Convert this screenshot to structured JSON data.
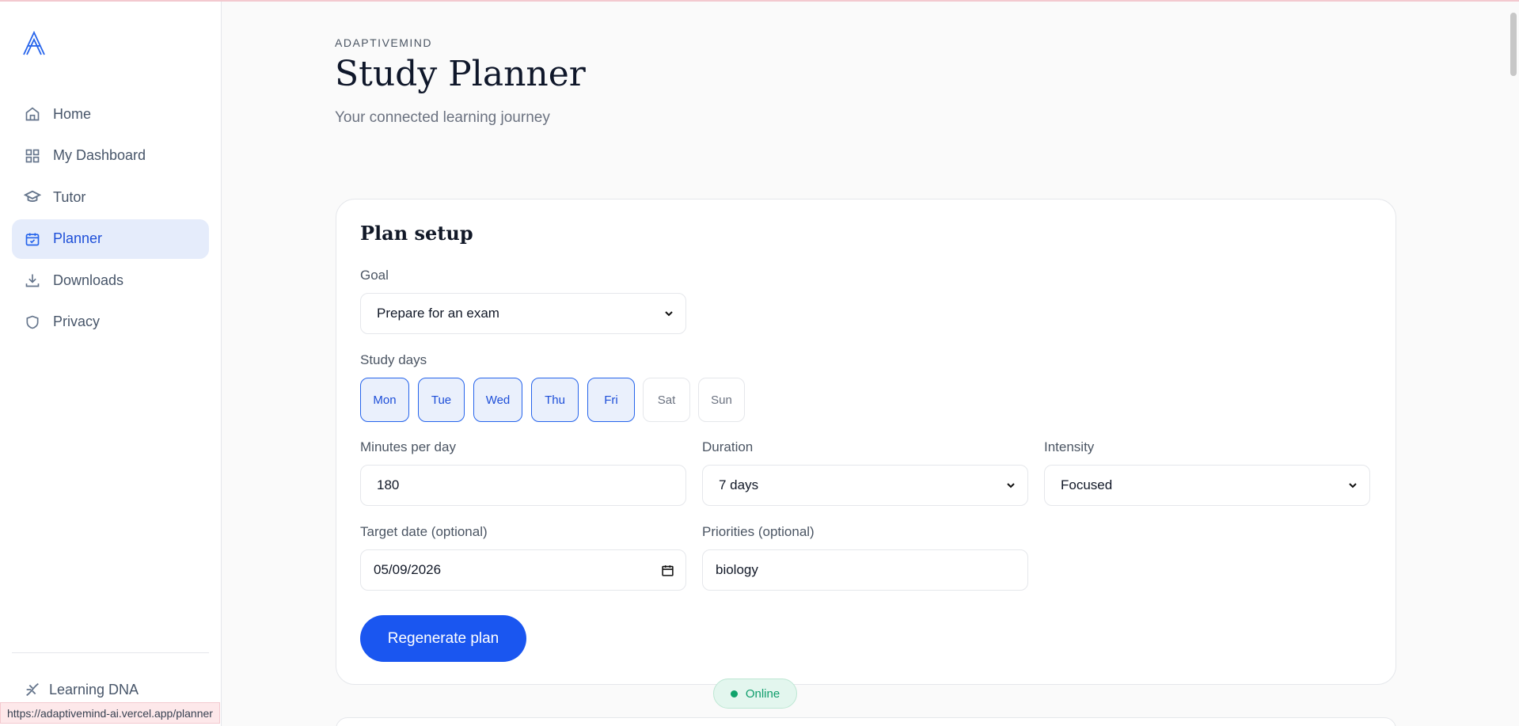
{
  "sidebar": {
    "items": [
      {
        "label": "Home",
        "icon": "home-icon"
      },
      {
        "label": "My Dashboard",
        "icon": "dashboard-icon"
      },
      {
        "label": "Tutor",
        "icon": "graduation-cap-icon"
      },
      {
        "label": "Planner",
        "icon": "calendar-check-icon",
        "active": true
      },
      {
        "label": "Downloads",
        "icon": "download-icon"
      },
      {
        "label": "Privacy",
        "icon": "shield-icon"
      }
    ],
    "footer_label": "Learning DNA"
  },
  "header": {
    "brand": "ADAPTIVEMIND",
    "title": "Study Planner",
    "subtitle": "Your connected learning journey"
  },
  "plan_setup": {
    "title": "Plan setup",
    "goal": {
      "label": "Goal",
      "value": "Prepare for an exam"
    },
    "study_days": {
      "label": "Study days",
      "days": [
        {
          "label": "Mon",
          "selected": true
        },
        {
          "label": "Tue",
          "selected": true
        },
        {
          "label": "Wed",
          "selected": true
        },
        {
          "label": "Thu",
          "selected": true
        },
        {
          "label": "Fri",
          "selected": true
        },
        {
          "label": "Sat",
          "selected": false
        },
        {
          "label": "Sun",
          "selected": false
        }
      ]
    },
    "minutes": {
      "label": "Minutes per day",
      "value": "180"
    },
    "duration": {
      "label": "Duration",
      "value": "7 days"
    },
    "intensity": {
      "label": "Intensity",
      "value": "Focused"
    },
    "target_date": {
      "label": "Target date (optional)",
      "value": "05/09/2026"
    },
    "priorities": {
      "label": "Priorities (optional)",
      "value": "biology"
    },
    "regenerate_label": "Regenerate plan"
  },
  "status": {
    "online_label": "Online"
  },
  "browser": {
    "status_url": "https://adaptivemind-ai.vercel.app/planner"
  },
  "colors": {
    "accent": "#1a56f0",
    "active_bg": "#e5ecfb",
    "online": "#10a36b"
  }
}
